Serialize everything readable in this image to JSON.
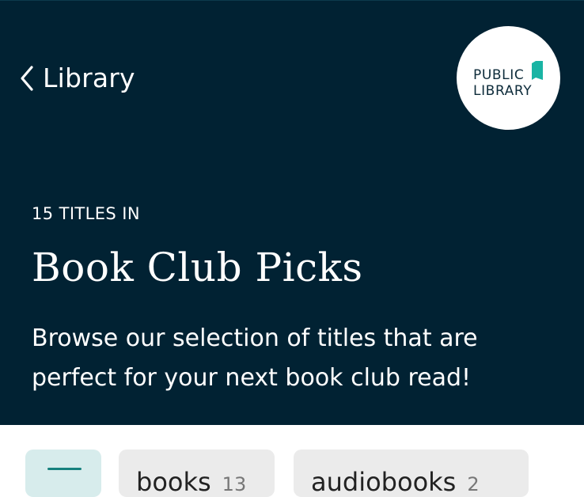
{
  "nav": {
    "back_label": "Library"
  },
  "logo": {
    "line1": "PUBLIC",
    "line2": "LIBRARY"
  },
  "collection": {
    "eyebrow": "15 TITLES IN",
    "title": "Book Club Picks",
    "description": "Browse our selection of titles that are perfect for your next book club read!"
  },
  "filters": {
    "chips": [
      {
        "label": "books",
        "count": "13"
      },
      {
        "label": "audiobooks",
        "count": "2"
      }
    ]
  },
  "colors": {
    "header_bg": "#012233",
    "accent": "#17817e",
    "logo_mark": "#19b4a4"
  },
  "icons": [
    "chevron-left-icon",
    "library-book-icon",
    "menu-icon"
  ]
}
